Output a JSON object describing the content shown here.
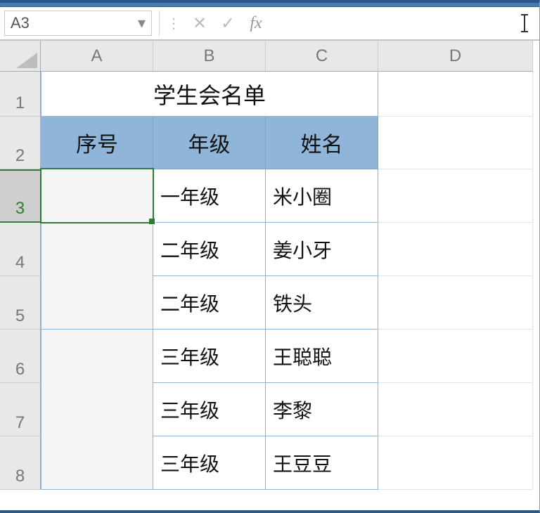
{
  "formula_bar": {
    "cell_ref": "A3",
    "fx_label": "fx",
    "input_value": ""
  },
  "columns": [
    "A",
    "B",
    "C",
    "D"
  ],
  "rows": [
    "1",
    "2",
    "3",
    "4",
    "5",
    "6",
    "7",
    "8"
  ],
  "title": "学生会名单",
  "headers": {
    "seq": "序号",
    "grade": "年级",
    "name": "姓名"
  },
  "data": [
    {
      "grade": "一年级",
      "name": "米小圈"
    },
    {
      "grade": "二年级",
      "name": "姜小牙"
    },
    {
      "grade": "二年级",
      "name": "铁头"
    },
    {
      "grade": "三年级",
      "name": "王聪聪"
    },
    {
      "grade": "三年级",
      "name": "李黎"
    },
    {
      "grade": "三年级",
      "name": "王豆豆"
    }
  ],
  "selected_cell": "A3"
}
